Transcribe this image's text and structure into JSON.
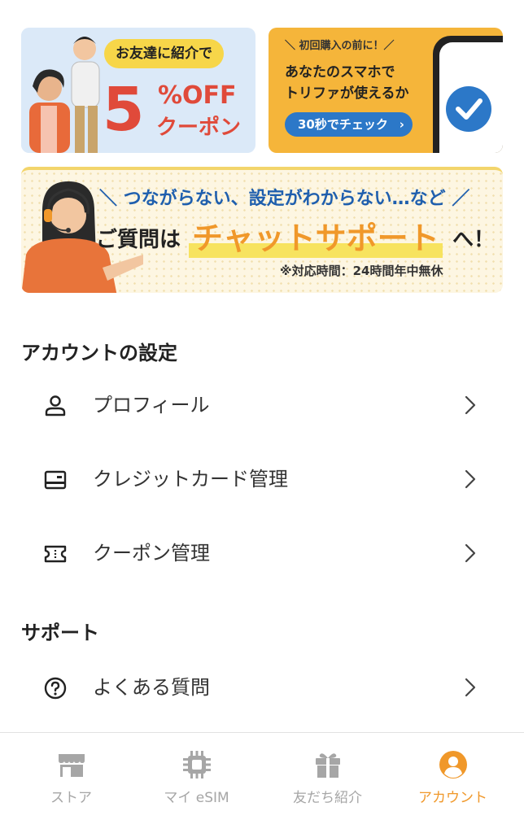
{
  "banners": {
    "coupon": {
      "bubble": "お友達に紹介で",
      "big_number": "5",
      "percent_off": "%OFF",
      "coupon": "クーポン"
    },
    "check": {
      "pre": "＼ 初回購入の前に！／",
      "line1": "あなたのスマホで",
      "line2": "トリファが使えるか",
      "button": "30秒でチェック",
      "button_arrow": "›"
    },
    "chat": {
      "top": "＼ つながらない、設定がわからない…など ／",
      "mid_pre": "ご質問は",
      "mid_em": "チャットサポート",
      "mid_post": "へ！",
      "hours": "※対応時間：24時間年中無休"
    }
  },
  "account_section": {
    "title": "アカウントの設定",
    "items": [
      {
        "label": "プロフィール",
        "icon": "person-icon"
      },
      {
        "label": "クレジットカード管理",
        "icon": "credit-card-icon"
      },
      {
        "label": "クーポン管理",
        "icon": "ticket-icon"
      }
    ]
  },
  "support_section": {
    "title": "サポート",
    "items": [
      {
        "label": "よくある質問",
        "icon": "question-circle-icon"
      }
    ]
  },
  "tabbar": {
    "tabs": [
      {
        "label": "ストア",
        "icon": "store-icon",
        "active": false
      },
      {
        "label": "マイ eSIM",
        "icon": "chip-icon",
        "active": false
      },
      {
        "label": "友だち紹介",
        "icon": "gift-icon",
        "active": false
      },
      {
        "label": "アカウント",
        "icon": "account-circle-icon",
        "active": true
      }
    ]
  },
  "colors": {
    "accent": "#f0982a",
    "inactive": "#a6a6a6",
    "coupon_red": "#e04a3a",
    "check_orange": "#f5b53a",
    "check_blue": "#2c78c8"
  }
}
